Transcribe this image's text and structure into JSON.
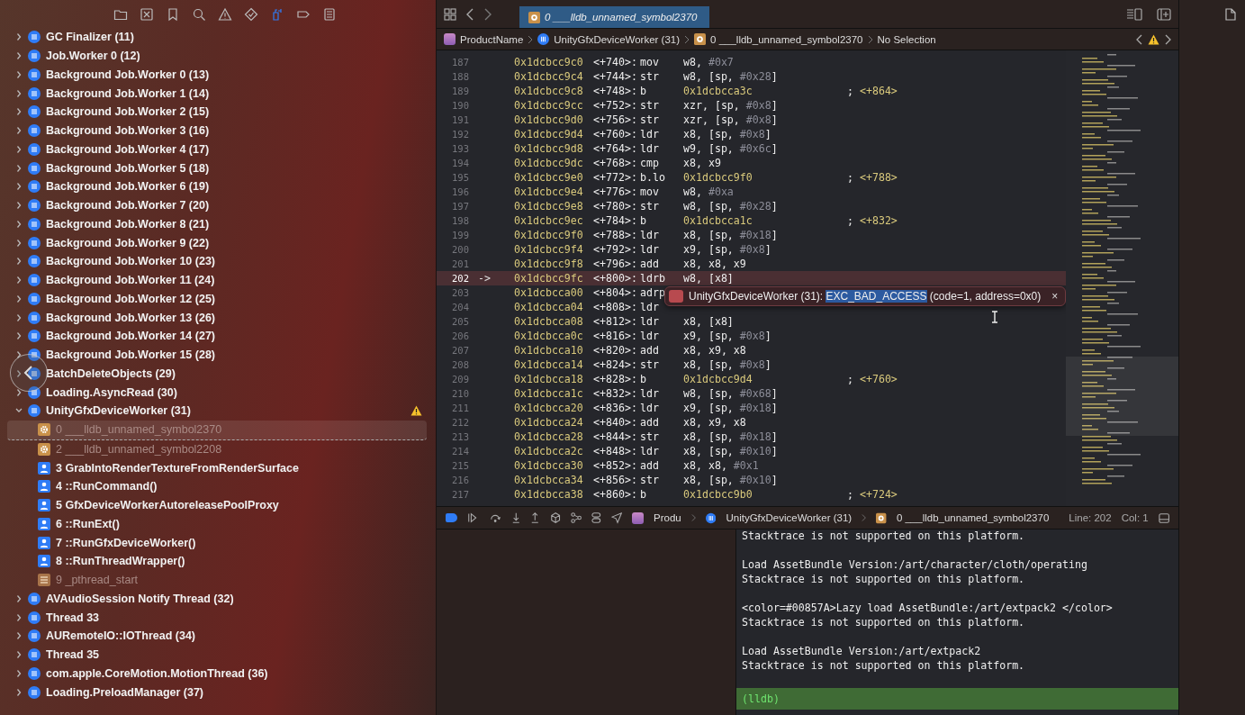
{
  "navigator_tabs": [
    {
      "kind": "folder",
      "selected": false
    },
    {
      "kind": "source-control",
      "selected": false
    },
    {
      "kind": "bookmark",
      "selected": false
    },
    {
      "kind": "search",
      "selected": false
    },
    {
      "kind": "issue",
      "selected": false
    },
    {
      "kind": "test",
      "selected": false
    },
    {
      "kind": "debug",
      "selected": true
    },
    {
      "kind": "breakpoint",
      "selected": false
    },
    {
      "kind": "report",
      "selected": false
    }
  ],
  "threads": [
    {
      "label": "GC Finalizer (11)",
      "expanded": false
    },
    {
      "label": "Job.Worker 0 (12)",
      "expanded": false
    },
    {
      "label": "Background Job.Worker 0 (13)",
      "expanded": false
    },
    {
      "label": "Background Job.Worker 1 (14)",
      "expanded": false
    },
    {
      "label": "Background Job.Worker 2 (15)",
      "expanded": false
    },
    {
      "label": "Background Job.Worker 3 (16)",
      "expanded": false
    },
    {
      "label": "Background Job.Worker 4 (17)",
      "expanded": false
    },
    {
      "label": "Background Job.Worker 5 (18)",
      "expanded": false
    },
    {
      "label": "Background Job.Worker 6 (19)",
      "expanded": false
    },
    {
      "label": "Background Job.Worker 7 (20)",
      "expanded": false
    },
    {
      "label": "Background Job.Worker 8 (21)",
      "expanded": false
    },
    {
      "label": "Background Job.Worker 9 (22)",
      "expanded": false
    },
    {
      "label": "Background Job.Worker 10 (23)",
      "expanded": false
    },
    {
      "label": "Background Job.Worker 11 (24)",
      "expanded": false
    },
    {
      "label": "Background Job.Worker 12 (25)",
      "expanded": false
    },
    {
      "label": "Background Job.Worker 13 (26)",
      "expanded": false
    },
    {
      "label": "Background Job.Worker 14 (27)",
      "expanded": false
    },
    {
      "label": "Background Job.Worker 15 (28)",
      "expanded": false
    },
    {
      "label": "BatchDeleteObjects (29)",
      "expanded": false
    },
    {
      "label": "Loading.AsyncRead (30)",
      "expanded": false
    },
    {
      "label": "UnityGfxDeviceWorker (31)",
      "expanded": true,
      "warning": true,
      "children": [
        {
          "label": "0 ___lldb_unnamed_symbol2370",
          "kind": "symbol",
          "selected": true
        },
        {
          "label": "2 ___lldb_unnamed_symbol2208",
          "kind": "symbol",
          "selected": false
        },
        {
          "label": "3 GrabIntoRenderTextureFromRenderSurface",
          "kind": "user",
          "selected": false
        },
        {
          "label": "4 ::RunCommand()",
          "kind": "user",
          "selected": false
        },
        {
          "label": "5 GfxDeviceWorkerAutoreleasePoolProxy",
          "kind": "user",
          "selected": false
        },
        {
          "label": "6 ::RunExt()",
          "kind": "user",
          "selected": false
        },
        {
          "label": "7 ::RunGfxDeviceWorker()",
          "kind": "user",
          "selected": false
        },
        {
          "label": "8 ::RunThreadWrapper()",
          "kind": "user",
          "selected": false
        },
        {
          "label": "9 _pthread_start",
          "kind": "library",
          "selected": false
        }
      ]
    },
    {
      "label": "AVAudioSession Notify Thread (32)",
      "expanded": false
    },
    {
      "label": "Thread 33",
      "expanded": false
    },
    {
      "label": "AURemoteIO::IOThread (34)",
      "expanded": false
    },
    {
      "label": "Thread 35",
      "expanded": false
    },
    {
      "label": "com.apple.CoreMotion.MotionThread (36)",
      "expanded": false
    },
    {
      "label": "Loading.PreloadManager (37)",
      "expanded": false
    }
  ],
  "editor_tab": {
    "label": "0 ___lldb_unnamed_symbol2370",
    "selected": true
  },
  "breadcrumb": [
    {
      "kind": "app",
      "label": "ProductName"
    },
    {
      "kind": "thread",
      "label": "UnityGfxDeviceWorker (31)"
    },
    {
      "kind": "symbol",
      "label": "0 ___lldb_unnamed_symbol2370"
    },
    {
      "kind": "plain",
      "label": "No Selection"
    }
  ],
  "code_lines": [
    {
      "number": "187",
      "address": "0x1dcbcc9c0",
      "offset": "<+740>:",
      "op": "mov",
      "operands": "w8, #0x7",
      "current": false
    },
    {
      "number": "188",
      "address": "0x1dcbcc9c4",
      "offset": "<+744>:",
      "op": "str",
      "operands": "w8, [sp, #0x28]",
      "current": false
    },
    {
      "number": "189",
      "address": "0x1dcbcc9c8",
      "offset": "<+748>:",
      "op": "b",
      "operands": "0x1dcbcca3c",
      "comment": "; <+864>",
      "current": false
    },
    {
      "number": "190",
      "address": "0x1dcbcc9cc",
      "offset": "<+752>:",
      "op": "str",
      "operands": "xzr, [sp, #0x8]",
      "current": false
    },
    {
      "number": "191",
      "address": "0x1dcbcc9d0",
      "offset": "<+756>:",
      "op": "str",
      "operands": "xzr, [sp, #0x8]",
      "current": false
    },
    {
      "number": "192",
      "address": "0x1dcbcc9d4",
      "offset": "<+760>:",
      "op": "ldr",
      "operands": "x8, [sp, #0x8]",
      "current": false
    },
    {
      "number": "193",
      "address": "0x1dcbcc9d8",
      "offset": "<+764>:",
      "op": "ldr",
      "operands": "w9, [sp, #0x6c]",
      "current": false
    },
    {
      "number": "194",
      "address": "0x1dcbcc9dc",
      "offset": "<+768>:",
      "op": "cmp",
      "operands": "x8, x9",
      "current": false
    },
    {
      "number": "195",
      "address": "0x1dcbcc9e0",
      "offset": "<+772>:",
      "op": "b.lo",
      "operands": "0x1dcbcc9f0",
      "comment": "; <+788>",
      "current": false
    },
    {
      "number": "196",
      "address": "0x1dcbcc9e4",
      "offset": "<+776>:",
      "op": "mov",
      "operands": "w8, #0xa",
      "current": false
    },
    {
      "number": "197",
      "address": "0x1dcbcc9e8",
      "offset": "<+780>:",
      "op": "str",
      "operands": "w8, [sp, #0x28]",
      "current": false
    },
    {
      "number": "198",
      "address": "0x1dcbcc9ec",
      "offset": "<+784>:",
      "op": "b",
      "operands": "0x1dcbcca1c",
      "comment": "; <+832>",
      "current": false
    },
    {
      "number": "199",
      "address": "0x1dcbcc9f0",
      "offset": "<+788>:",
      "op": "ldr",
      "operands": "x8, [sp, #0x18]",
      "current": false
    },
    {
      "number": "200",
      "address": "0x1dcbcc9f4",
      "offset": "<+792>:",
      "op": "ldr",
      "operands": "x9, [sp, #0x8]",
      "current": false
    },
    {
      "number": "201",
      "address": "0x1dcbcc9f8",
      "offset": "<+796>:",
      "op": "add",
      "operands": "x8, x8, x9",
      "current": false
    },
    {
      "number": "202",
      "marker": "->",
      "address": "0x1dcbcc9fc",
      "offset": "<+800>:",
      "op": "ldrb",
      "operands": "w8, [x8]",
      "current": true
    },
    {
      "number": "203",
      "address": "0x1dcbcca00",
      "offset": "<+804>:",
      "op": "adrp",
      "current": false
    },
    {
      "number": "204",
      "address": "0x1dcbcca04",
      "offset": "<+808>:",
      "op": "ldr",
      "current": false
    },
    {
      "number": "205",
      "address": "0x1dcbcca08",
      "offset": "<+812>:",
      "op": "ldr",
      "operands": "x8, [x8]",
      "current": false
    },
    {
      "number": "206",
      "address": "0x1dcbcca0c",
      "offset": "<+816>:",
      "op": "ldr",
      "operands": "x9, [sp, #0x8]",
      "current": false
    },
    {
      "number": "207",
      "address": "0x1dcbcca10",
      "offset": "<+820>:",
      "op": "add",
      "operands": "x8, x9, x8",
      "current": false
    },
    {
      "number": "208",
      "address": "0x1dcbcca14",
      "offset": "<+824>:",
      "op": "str",
      "operands": "x8, [sp, #0x8]",
      "current": false
    },
    {
      "number": "209",
      "address": "0x1dcbcca18",
      "offset": "<+828>:",
      "op": "b",
      "operands": "0x1dcbcc9d4",
      "comment": "; <+760>",
      "current": false
    },
    {
      "number": "210",
      "address": "0x1dcbcca1c",
      "offset": "<+832>:",
      "op": "ldr",
      "operands": "w8, [sp, #0x68]",
      "current": false
    },
    {
      "number": "211",
      "address": "0x1dcbcca20",
      "offset": "<+836>:",
      "op": "ldr",
      "operands": "x9, [sp, #0x18]",
      "current": false
    },
    {
      "number": "212",
      "address": "0x1dcbcca24",
      "offset": "<+840>:",
      "op": "add",
      "operands": "x8, x9, x8",
      "current": false
    },
    {
      "number": "213",
      "address": "0x1dcbcca28",
      "offset": "<+844>:",
      "op": "str",
      "operands": "x8, [sp, #0x18]",
      "current": false
    },
    {
      "number": "214",
      "address": "0x1dcbcca2c",
      "offset": "<+848>:",
      "op": "ldr",
      "operands": "x8, [sp, #0x10]",
      "current": false
    },
    {
      "number": "215",
      "address": "0x1dcbcca30",
      "offset": "<+852>:",
      "op": "add",
      "operands": "x8, x8, #0x1",
      "current": false
    },
    {
      "number": "216",
      "address": "0x1dcbcca34",
      "offset": "<+856>:",
      "op": "str",
      "operands": "x8, [sp, #0x10]",
      "current": false
    },
    {
      "number": "217",
      "address": "0x1dcbcca38",
      "offset": "<+860>:",
      "op": "b",
      "operands": "0x1dcbcc9b0",
      "comment": "; <+724>",
      "current": false
    }
  ],
  "error_banner": {
    "thread": "UnityGfxDeviceWorker (31):",
    "exception": "EXC_BAD_ACCESS",
    "detail": "(code=1, address=0x0)",
    "close": "×"
  },
  "debug_bar": {
    "breakpoints_active": true,
    "crumbs": [
      {
        "kind": "app",
        "label": "Produ"
      },
      {
        "kind": "thread",
        "label": "UnityGfxDeviceWorker (31)"
      },
      {
        "kind": "symbol",
        "label": "0 ___lldb_unnamed_symbol2370"
      }
    ],
    "line": "Line: 202",
    "column": "Col: 1"
  },
  "console": {
    "blocks": [
      [
        "Stacktrace is not supported on this platform."
      ],
      [
        "Load AssetBundle Version:/art/character/cloth/operating",
        "Stacktrace is not supported on this platform."
      ],
      [
        "<color=#00857A>Lazy load AssetBundle:/art/extpack2 </color>",
        "Stacktrace is not supported on this platform."
      ],
      [
        "Load AssetBundle Version:/art/extpack2",
        "Stacktrace is not supported on this platform."
      ]
    ],
    "prompt": "(lldb)"
  }
}
